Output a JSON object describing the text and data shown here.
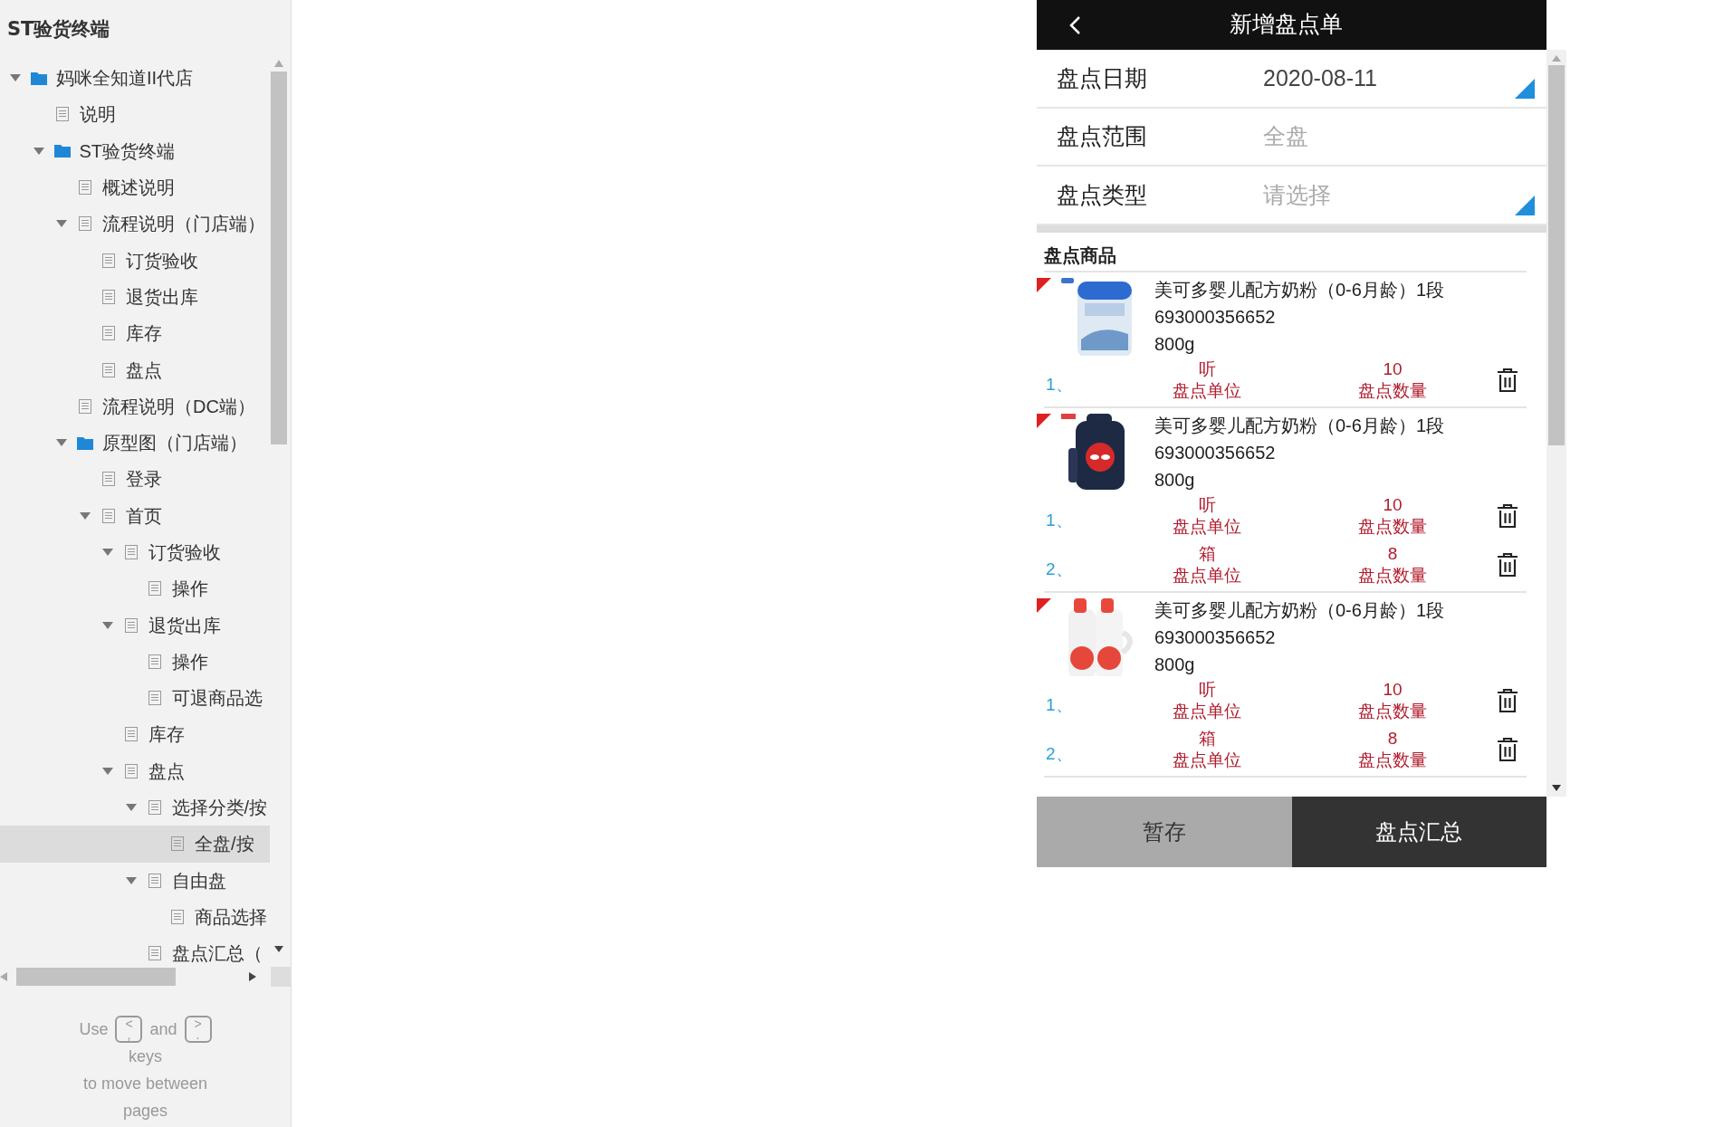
{
  "sidebar": {
    "title": "ST验货终端",
    "tree": [
      {
        "label": "妈咪全知道II代店",
        "kind": "folder",
        "expanded": true,
        "selected": false,
        "children": [
          {
            "label": "说明",
            "kind": "page",
            "selected": false
          },
          {
            "label": "ST验货终端",
            "kind": "folder",
            "expanded": true,
            "selected": false,
            "children": [
              {
                "label": "概述说明",
                "kind": "page",
                "selected": false
              },
              {
                "label": "流程说明（门店端）",
                "kind": "page",
                "expanded": true,
                "selected": false,
                "children": [
                  {
                    "label": "订货验收",
                    "kind": "page",
                    "selected": false
                  },
                  {
                    "label": "退货出库",
                    "kind": "page",
                    "selected": false
                  },
                  {
                    "label": "库存",
                    "kind": "page",
                    "selected": false
                  },
                  {
                    "label": "盘点",
                    "kind": "page",
                    "selected": false
                  }
                ]
              },
              {
                "label": "流程说明（DC端）",
                "kind": "page",
                "selected": false
              },
              {
                "label": "原型图（门店端）",
                "kind": "folder",
                "expanded": true,
                "selected": false,
                "children": [
                  {
                    "label": "登录",
                    "kind": "page",
                    "selected": false
                  },
                  {
                    "label": "首页",
                    "kind": "page",
                    "expanded": true,
                    "selected": false,
                    "children": [
                      {
                        "label": "订货验收",
                        "kind": "page",
                        "expanded": true,
                        "selected": false,
                        "children": [
                          {
                            "label": "操作",
                            "kind": "page",
                            "selected": false
                          }
                        ]
                      },
                      {
                        "label": "退货出库",
                        "kind": "page",
                        "expanded": true,
                        "selected": false,
                        "children": [
                          {
                            "label": "操作",
                            "kind": "page",
                            "selected": false
                          },
                          {
                            "label": "可退商品选",
                            "kind": "page",
                            "selected": false
                          }
                        ]
                      },
                      {
                        "label": "库存",
                        "kind": "page",
                        "selected": false
                      },
                      {
                        "label": "盘点",
                        "kind": "page",
                        "expanded": true,
                        "selected": false,
                        "children": [
                          {
                            "label": "选择分类/按",
                            "kind": "page",
                            "expanded": true,
                            "selected": false,
                            "children": [
                              {
                                "label": "全盘/按",
                                "kind": "page",
                                "selected": true
                              }
                            ]
                          },
                          {
                            "label": "自由盘",
                            "kind": "page",
                            "expanded": true,
                            "selected": false,
                            "children": [
                              {
                                "label": "商品选择",
                                "kind": "page",
                                "selected": false
                              }
                            ]
                          },
                          {
                            "label": "盘点汇总（",
                            "kind": "page",
                            "selected": false
                          }
                        ]
                      }
                    ]
                  }
                ]
              }
            ]
          }
        ]
      }
    ],
    "hint": {
      "before": "Use",
      "keys": [
        {
          "top": "<",
          "bottom": ","
        },
        {
          "top": ">",
          "bottom": "."
        }
      ],
      "middle": "and",
      "after": [
        "keys",
        "to move between",
        "pages"
      ]
    }
  },
  "phone": {
    "title": "新增盘点单",
    "fields": [
      {
        "label": "盘点日期",
        "value": "2020-08-11",
        "disabled": false,
        "dropdown": true
      },
      {
        "label": "盘点范围",
        "value": "全盘",
        "disabled": true,
        "dropdown": false
      },
      {
        "label": "盘点类型",
        "placeholder": "请选择",
        "disabled": false,
        "dropdown": true
      }
    ],
    "section_title": "盘点商品",
    "products": [
      {
        "name": "美可多婴儿配方奶粉（0-6月龄）1段",
        "code": "693000356652",
        "spec": "800g",
        "lines": [
          {
            "index": "1、",
            "unit": "听",
            "unit_label": "盘点单位",
            "qty": "10",
            "qty_label": "盘点数量"
          }
        ]
      },
      {
        "name": "美可多婴儿配方奶粉（0-6月龄）1段",
        "code": "693000356652",
        "spec": "800g",
        "lines": [
          {
            "index": "1、",
            "unit": "听",
            "unit_label": "盘点单位",
            "qty": "10",
            "qty_label": "盘点数量"
          },
          {
            "index": "2、",
            "unit": "箱",
            "unit_label": "盘点单位",
            "qty": "8",
            "qty_label": "盘点数量"
          }
        ]
      },
      {
        "name": "美可多婴儿配方奶粉（0-6月龄）1段",
        "code": "693000356652",
        "spec": "800g",
        "lines": [
          {
            "index": "1、",
            "unit": "听",
            "unit_label": "盘点单位",
            "qty": "10",
            "qty_label": "盘点数量"
          },
          {
            "index": "2、",
            "unit": "箱",
            "unit_label": "盘点单位",
            "qty": "8",
            "qty_label": "盘点数量"
          }
        ]
      }
    ],
    "buttons": [
      {
        "label": "暂存",
        "kind": "secondary"
      },
      {
        "label": "盘点汇总",
        "kind": "primary"
      }
    ]
  }
}
